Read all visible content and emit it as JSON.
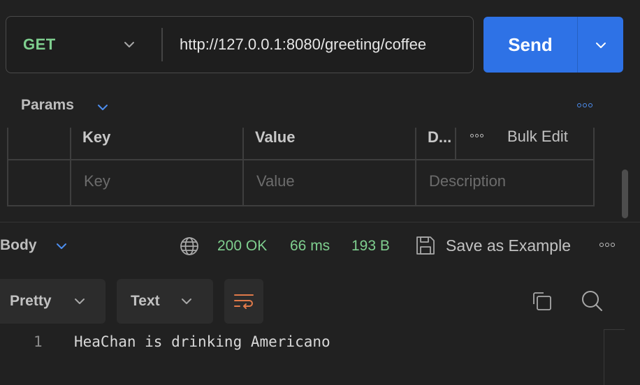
{
  "request": {
    "method": "GET",
    "url": "http://127.0.0.1:8080/greeting/coffee",
    "send_label": "Send"
  },
  "params": {
    "section_label": "Params",
    "bulk_edit_label": "Bulk Edit",
    "columns": {
      "key": "Key",
      "value": "Value",
      "description": "D..."
    },
    "placeholders": {
      "key": "Key",
      "value": "Value",
      "description": "Description"
    }
  },
  "response": {
    "section_label": "Body",
    "status": "200 OK",
    "time": "66 ms",
    "size": "193 B",
    "save_example_label": "Save as Example",
    "format_label": "Pretty",
    "type_label": "Text",
    "lines": [
      {
        "number": "1",
        "text": "HeaChan is drinking Americano"
      }
    ]
  },
  "colors": {
    "accent": "#2e72e6",
    "success": "#7fcf8f",
    "wrap_icon": "#e07a4a",
    "link_icon": "#4d8ef0"
  },
  "icons": [
    "chevron-down-icon",
    "more-horizontal-icon",
    "globe-icon",
    "save-icon",
    "wrap-lines-icon",
    "copy-icon",
    "search-icon"
  ]
}
